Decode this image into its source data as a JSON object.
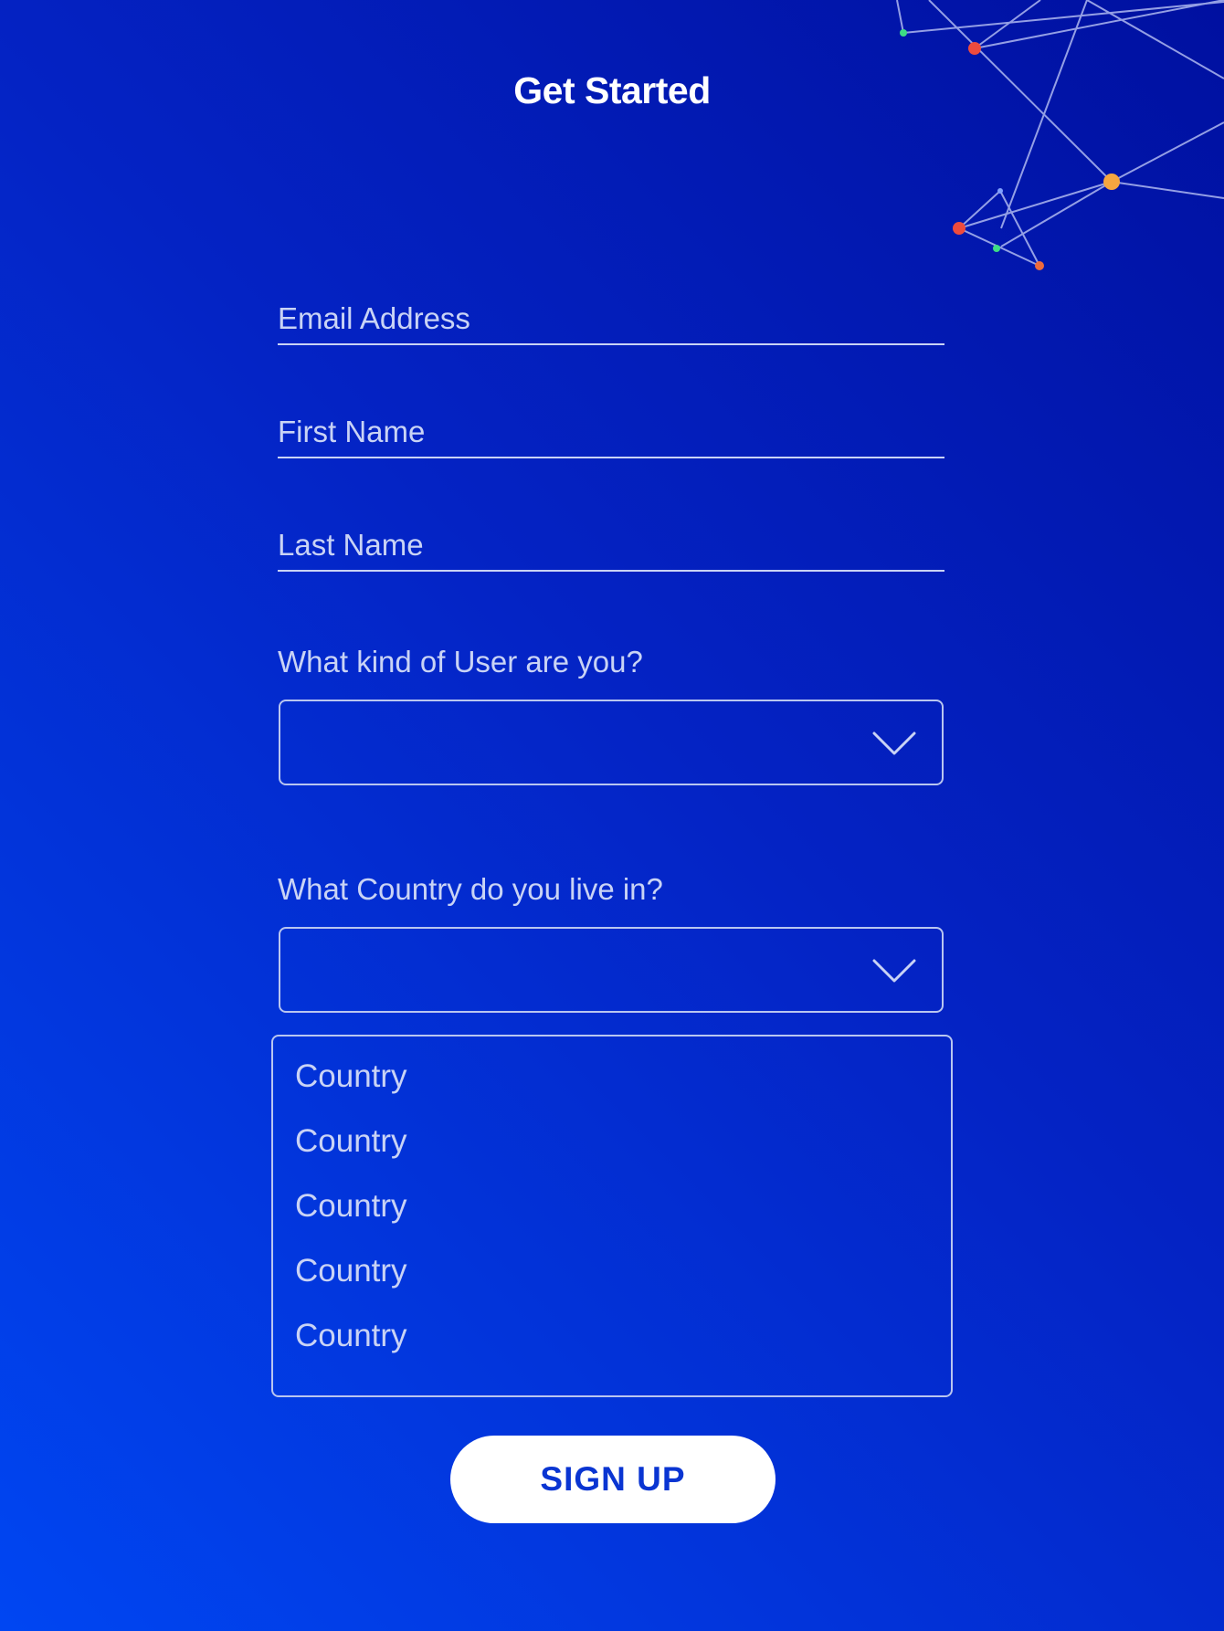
{
  "page": {
    "title": "Get Started"
  },
  "form": {
    "email_placeholder": "Email Address",
    "first_name_placeholder": "First Name",
    "last_name_placeholder": "Last Name",
    "user_type_label": "What kind of User are you?",
    "user_type_value": "",
    "country_label": "What Country do you live in?",
    "country_value": "",
    "country_options": [
      "Country",
      "Country",
      "Country",
      "Country",
      "Country"
    ],
    "signup_label": "SIGN UP"
  },
  "icons": {
    "select_arrow": "chevron-down-icon",
    "decoration": "network-graph-icon"
  },
  "colors": {
    "bg_light": "#0046f2",
    "bg_dark": "#0010a0",
    "text_muted": "#c9d3f5",
    "button_text": "#0a35d2",
    "node_red": "#ee4b3d",
    "node_orange": "#f6a640",
    "node_green": "#3ddc84"
  }
}
